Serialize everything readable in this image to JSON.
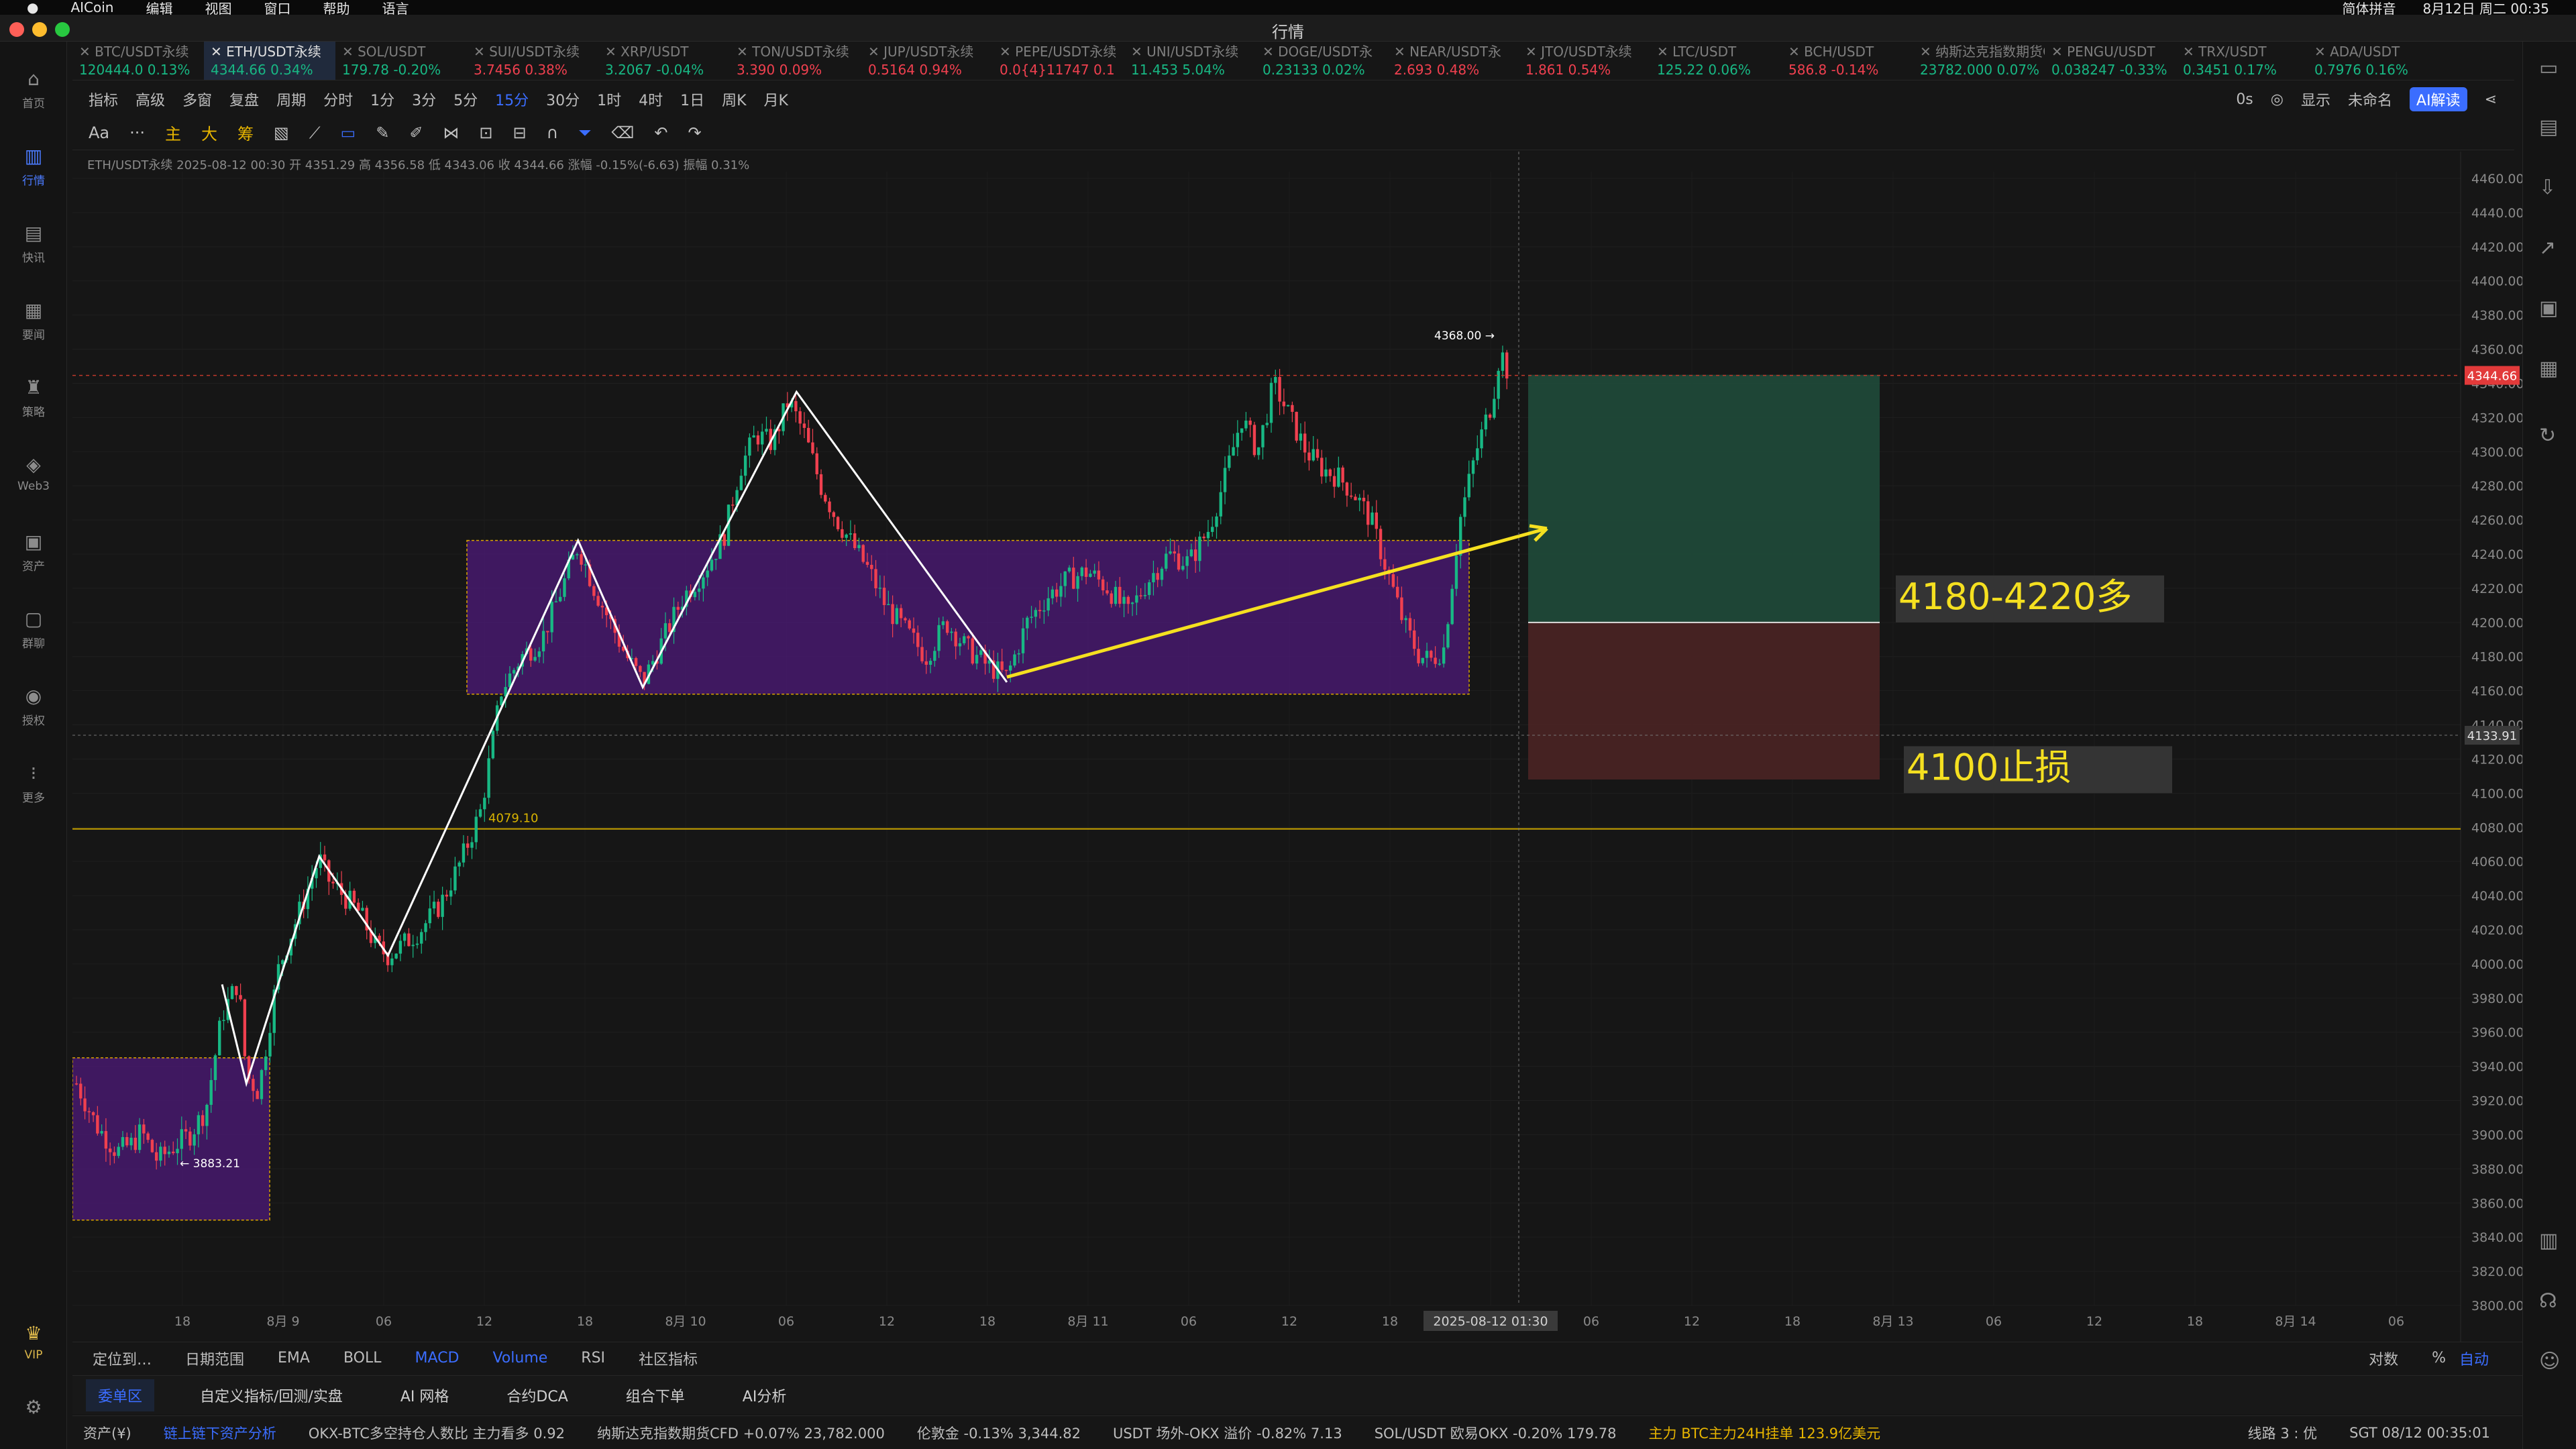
{
  "menubar": {
    "items": [
      "AICoin",
      "编辑",
      "视图",
      "窗口",
      "帮助",
      "语言"
    ],
    "right": [
      "简体拼音",
      "8月12日 周二 00:35"
    ]
  },
  "window": {
    "title": "行情"
  },
  "sidebar": {
    "items": [
      {
        "label": "首页",
        "icon": "home-icon"
      },
      {
        "label": "行情",
        "icon": "market-icon"
      },
      {
        "label": "快讯",
        "icon": "news-icon"
      },
      {
        "label": "要闻",
        "icon": "headline-icon"
      },
      {
        "label": "策略",
        "icon": "strategy-icon"
      },
      {
        "label": "Web3",
        "icon": "web3-icon"
      },
      {
        "label": "资产",
        "icon": "asset-icon"
      },
      {
        "label": "群聊",
        "icon": "chat-icon"
      },
      {
        "label": "授权",
        "icon": "auth-icon"
      },
      {
        "label": "更多",
        "icon": "more-icon"
      },
      {
        "label": "VIP",
        "icon": "vip-icon"
      }
    ]
  },
  "tickers": [
    {
      "name": "BTC/USDT永续",
      "price": "120444.0",
      "chg": "0.13%",
      "up": true
    },
    {
      "name": "ETH/USDT永续",
      "price": "4344.66",
      "chg": "0.34%",
      "up": true,
      "active": true
    },
    {
      "name": "SOL/USDT",
      "price": "179.78",
      "chg": "-0.20%",
      "up": true
    },
    {
      "name": "SUI/USDT永续",
      "price": "3.7456",
      "chg": "0.38%",
      "up": false
    },
    {
      "name": "XRP/USDT",
      "price": "3.2067",
      "chg": "-0.04%",
      "up": true
    },
    {
      "name": "TON/USDT永续",
      "price": "3.390",
      "chg": "0.09%",
      "up": false
    },
    {
      "name": "JUP/USDT永续",
      "price": "0.5164",
      "chg": "0.94%",
      "up": false
    },
    {
      "name": "PEPE/USDT永续",
      "price": "0.0{4}11747",
      "chg": "0.1",
      "up": false
    },
    {
      "name": "UNI/USDT永续",
      "price": "11.453",
      "chg": "5.04%",
      "up": true
    },
    {
      "name": "DOGE/USDT永",
      "price": "0.23133",
      "chg": "0.02%",
      "up": true
    },
    {
      "name": "NEAR/USDT永",
      "price": "2.693",
      "chg": "0.48%",
      "up": false
    },
    {
      "name": "JTO/USDT永续",
      "price": "1.861",
      "chg": "0.54%",
      "up": false
    },
    {
      "name": "LTC/USDT",
      "price": "125.22",
      "chg": "0.06%",
      "up": true
    },
    {
      "name": "BCH/USDT",
      "price": "586.8",
      "chg": "-0.14%",
      "up": false
    },
    {
      "name": "纳斯达克指数期货CFD",
      "price": "23782.000",
      "chg": "0.07%",
      "up": true
    },
    {
      "name": "PENGU/USDT",
      "price": "0.038247",
      "chg": "-0.33%",
      "up": true
    },
    {
      "name": "TRX/USDT",
      "price": "0.3451",
      "chg": "0.17%",
      "up": true
    },
    {
      "name": "ADA/USDT",
      "price": "0.7976",
      "chg": "0.16%",
      "up": true
    }
  ],
  "toolbar1": {
    "items": [
      "指标",
      "高级",
      "多窗",
      "复盘",
      "周期",
      "分时",
      "1分",
      "3分",
      "5分",
      "15分",
      "30分",
      "1时",
      "4时",
      "1日",
      "周K",
      "月K"
    ],
    "active": "15分",
    "right": [
      "0s",
      "显示",
      "未命名",
      "AI解读"
    ]
  },
  "toolbar2": {
    "items": [
      "Aa",
      "···",
      "主",
      "大",
      "筹"
    ]
  },
  "chart_header": "ETH/USDT永续  2025-08-12 00:30  开 4351.29  高 4356.58  低 4343.06  收 4344.66  涨幅 -0.15%(-6.63)  振幅 0.31%",
  "chart_data": {
    "type": "candlestick",
    "symbol": "ETH/USDT永续",
    "interval": "15分",
    "ylim": [
      3800,
      4460
    ],
    "y_ticks": [
      4460,
      4440,
      4420,
      4400,
      4380,
      4360,
      4340,
      4320,
      4300,
      4280,
      4260,
      4240,
      4220,
      4200,
      4180,
      4160,
      4140,
      4120,
      4100,
      4080,
      4060,
      4040,
      4020,
      4000,
      3980,
      3960,
      3940,
      3920,
      3900,
      3880,
      3860,
      3840,
      3820,
      3800
    ],
    "x_ticks": [
      "18",
      "8月 9",
      "06",
      "12",
      "18",
      "8月 10",
      "06",
      "12",
      "18",
      "8月 11",
      "06",
      "12",
      "18",
      "2025-08-12 01:30",
      "06",
      "12",
      "18",
      "8月 13",
      "06",
      "12",
      "18",
      "8月 14",
      "06"
    ],
    "price_path": [
      [
        0,
        3930
      ],
      [
        0.05,
        3905
      ],
      [
        0.1,
        3890
      ],
      [
        0.14,
        3895
      ],
      [
        0.16,
        3902
      ],
      [
        0.2,
        3885
      ],
      [
        0.25,
        3895
      ],
      [
        0.28,
        3900
      ],
      [
        0.32,
        3915
      ],
      [
        0.36,
        3970
      ],
      [
        0.4,
        3990
      ],
      [
        0.42,
        3935
      ],
      [
        0.45,
        3925
      ],
      [
        0.5,
        3998
      ],
      [
        0.55,
        4030
      ],
      [
        0.6,
        4062
      ],
      [
        0.62,
        4050
      ],
      [
        0.66,
        4040
      ],
      [
        0.7,
        4030
      ],
      [
        0.74,
        4010
      ],
      [
        0.77,
        4005
      ],
      [
        0.8,
        4010
      ],
      [
        0.85,
        4020
      ],
      [
        0.9,
        4035
      ],
      [
        0.95,
        4060
      ],
      [
        1.0,
        4090
      ],
      [
        1.05,
        4160
      ],
      [
        1.1,
        4180
      ],
      [
        1.15,
        4190
      ],
      [
        1.2,
        4220
      ],
      [
        1.24,
        4245
      ],
      [
        1.28,
        4220
      ],
      [
        1.32,
        4200
      ],
      [
        1.36,
        4180
      ],
      [
        1.4,
        4165
      ],
      [
        1.45,
        4190
      ],
      [
        1.5,
        4215
      ],
      [
        1.55,
        4230
      ],
      [
        1.6,
        4250
      ],
      [
        1.64,
        4290
      ],
      [
        1.68,
        4310
      ],
      [
        1.72,
        4305
      ],
      [
        1.76,
        4330
      ],
      [
        1.8,
        4310
      ],
      [
        1.84,
        4280
      ],
      [
        1.88,
        4260
      ],
      [
        1.92,
        4245
      ],
      [
        1.96,
        4230
      ],
      [
        2.0,
        4210
      ],
      [
        2.05,
        4195
      ],
      [
        2.1,
        4180
      ],
      [
        2.15,
        4200
      ],
      [
        2.2,
        4185
      ],
      [
        2.25,
        4175
      ],
      [
        2.3,
        4168
      ],
      [
        2.35,
        4200
      ],
      [
        2.4,
        4215
      ],
      [
        2.45,
        4225
      ],
      [
        2.5,
        4230
      ],
      [
        2.55,
        4220
      ],
      [
        2.6,
        4205
      ],
      [
        2.65,
        4225
      ],
      [
        2.7,
        4240
      ],
      [
        2.75,
        4235
      ],
      [
        2.8,
        4255
      ],
      [
        2.84,
        4285
      ],
      [
        2.88,
        4320
      ],
      [
        2.92,
        4300
      ],
      [
        2.96,
        4340
      ],
      [
        3.0,
        4320
      ],
      [
        3.04,
        4300
      ],
      [
        3.08,
        4290
      ],
      [
        3.12,
        4285
      ],
      [
        3.16,
        4275
      ],
      [
        3.2,
        4260
      ],
      [
        3.24,
        4230
      ],
      [
        3.28,
        4200
      ],
      [
        3.32,
        4180
      ],
      [
        3.35,
        4178
      ],
      [
        3.38,
        4185
      ],
      [
        3.42,
        4260
      ],
      [
        3.46,
        4300
      ],
      [
        3.5,
        4330
      ],
      [
        3.52,
        4360
      ],
      [
        3.54,
        4345
      ]
    ],
    "last_price": "4344.66",
    "crosshair_price": "4133.91",
    "annotations": {
      "high": "4368.00 →",
      "low": "← 3883.21",
      "hline": "4079.10",
      "entry": "4180-4220多",
      "stop": "4100止损"
    },
    "zones": [
      {
        "name": "lower-box",
        "y": [
          3850,
          3945
        ]
      },
      {
        "name": "consolidation-box",
        "y": [
          4158,
          4248
        ]
      }
    ],
    "position": {
      "take_profit": [
        4200,
        4345
      ],
      "stop_loss": [
        4108,
        4200
      ]
    },
    "colors": {
      "up": "#18b884",
      "down": "#f0404f",
      "box": "#5a1f8a",
      "line": "#f5e020",
      "zig": "#ffffff"
    }
  },
  "bottomtabs": {
    "items": [
      "定位到…",
      "日期范围",
      "EMA",
      "BOLL",
      "MACD",
      "Volume",
      "RSI",
      "社区指标"
    ],
    "active": [
      "MACD",
      "Volume"
    ],
    "right": [
      "对数",
      "%",
      "自动"
    ]
  },
  "ordertabs": {
    "items": [
      "委单区",
      "自定义指标/回测/实盘",
      "AI 网格",
      "合约DCA",
      "组合下单",
      "AI分析"
    ],
    "active": "委单区"
  },
  "statusbar": {
    "items": [
      "资产(¥)",
      "链上链下资产分析",
      "OKX-BTC多空持仓人数比 主力看多 0.92",
      "纳斯达克指数期货CFD +0.07% 23,782.000",
      "伦敦金 -0.13% 3,344.82",
      "USDT 场外-OKX 溢价 -0.82% 7.13",
      "SOL/USDT 欧易OKX -0.20% 179.78",
      "主力 BTC主力24H挂单 123.9亿美元"
    ],
    "right": [
      "线路 3 : 优",
      "SGT 08/12 00:35:01"
    ]
  }
}
